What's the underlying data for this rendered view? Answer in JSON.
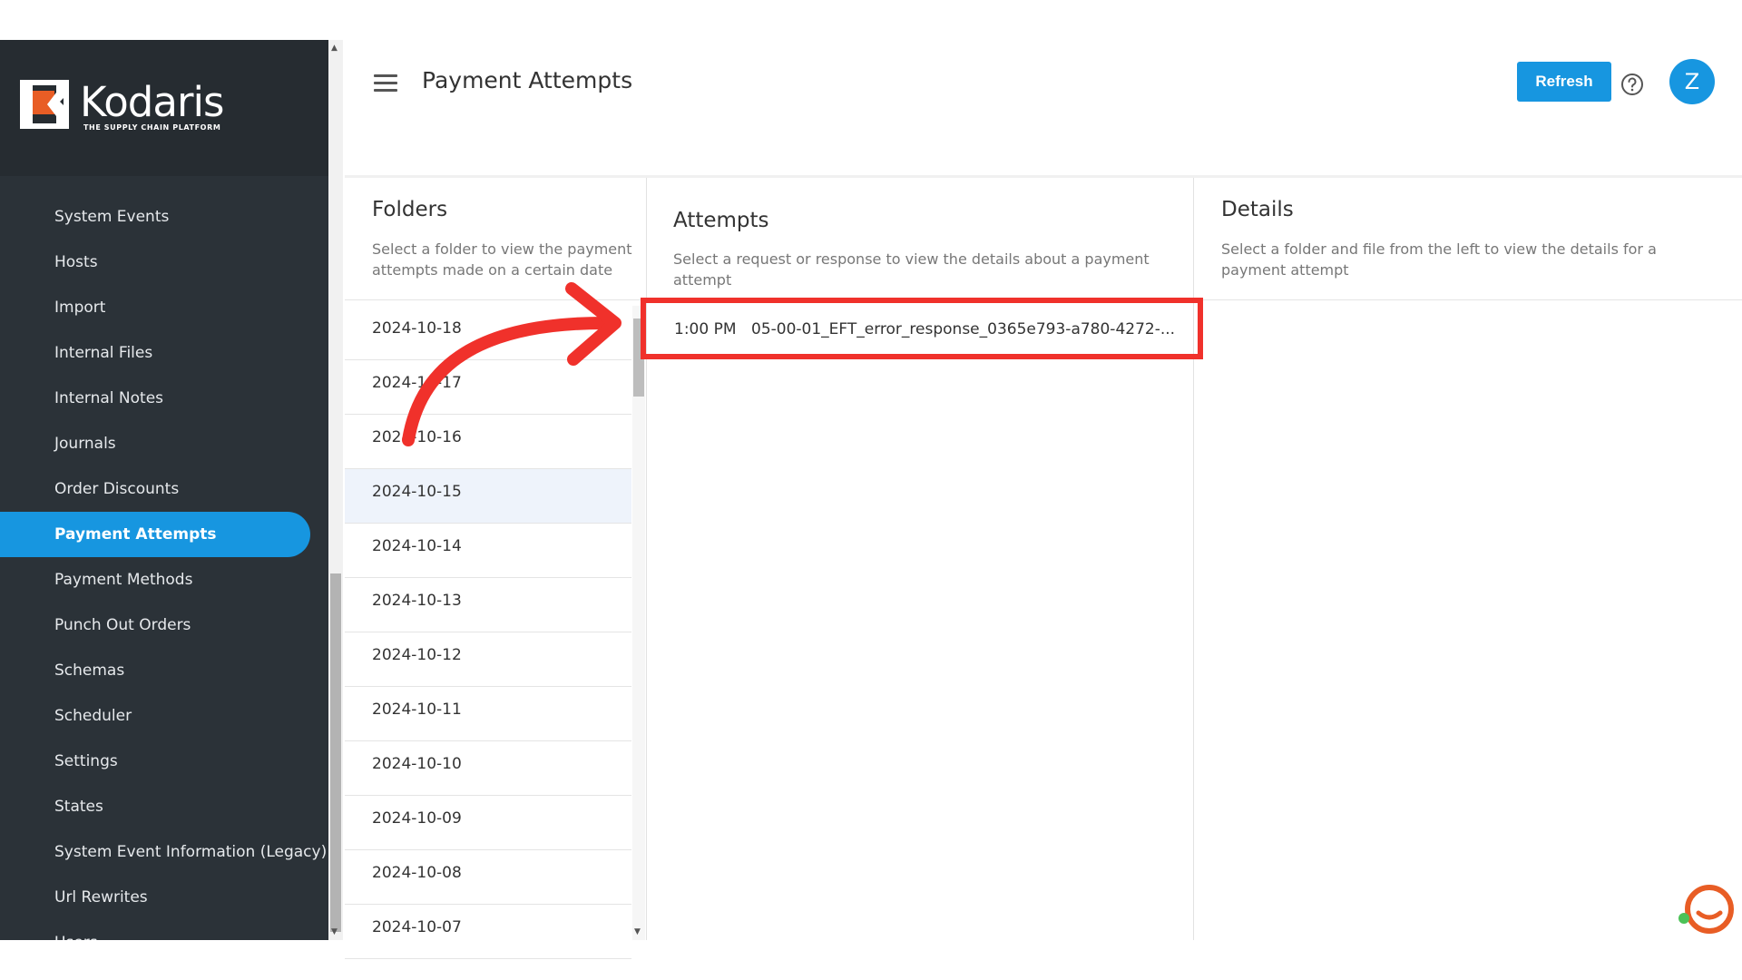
{
  "app": {
    "logo_text": "Kodaris",
    "logo_tagline": "THE SUPPLY CHAIN PLATFORM"
  },
  "sidebar": {
    "items": [
      {
        "label": "System Events"
      },
      {
        "label": "Hosts"
      },
      {
        "label": "Import"
      },
      {
        "label": "Internal Files"
      },
      {
        "label": "Internal Notes"
      },
      {
        "label": "Journals"
      },
      {
        "label": "Order Discounts"
      },
      {
        "label": "Payment Attempts",
        "active": true
      },
      {
        "label": "Payment Methods"
      },
      {
        "label": "Punch Out Orders"
      },
      {
        "label": "Schemas"
      },
      {
        "label": "Scheduler"
      },
      {
        "label": "Settings"
      },
      {
        "label": "States"
      },
      {
        "label": "System Event Information (Legacy)"
      },
      {
        "label": "Url Rewrites"
      },
      {
        "label": "Users"
      }
    ]
  },
  "header": {
    "title": "Payment Attempts",
    "refresh_label": "Refresh",
    "avatar_initial": "Z",
    "menu_icon": "hamburger-icon",
    "help_icon": "help-circle-icon"
  },
  "folders": {
    "title": "Folders",
    "description": "Select a folder to view the payment attempts made on a certain date",
    "items": [
      "2024-10-18",
      "2024-10-17",
      "2024-10-16",
      "2024-10-15",
      "2024-10-14",
      "2024-10-13",
      "2024-10-12",
      "2024-10-11",
      "2024-10-10",
      "2024-10-09",
      "2024-10-08",
      "2024-10-07"
    ],
    "selected": "2024-10-15"
  },
  "attempts": {
    "title": "Attempts",
    "description": "Select a request or response to view the details about a payment attempt",
    "items": [
      {
        "time": "1:00 PM",
        "file": "05-00-01_EFT_error_response_0365e793-a780-4272-..."
      }
    ]
  },
  "details": {
    "title": "Details",
    "description": "Select a folder and file from the left to view the details for a payment attempt"
  },
  "colors": {
    "accent": "#1796e0",
    "sidebar_bg": "#2b3238",
    "highlight": "#f0312b",
    "logo_orange": "#e85d25"
  }
}
